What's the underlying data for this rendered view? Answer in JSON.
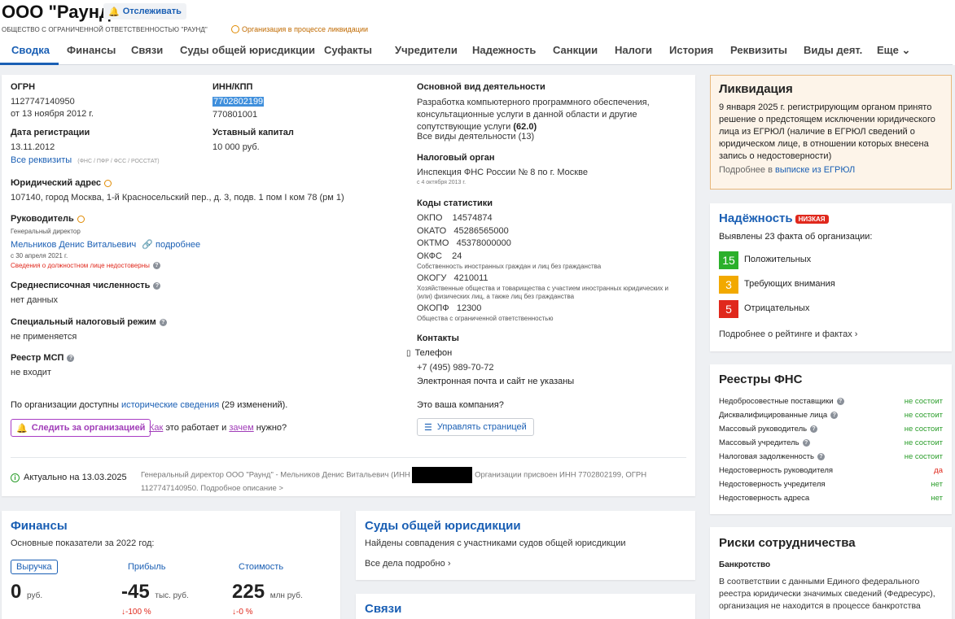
{
  "header": {
    "company_title": "ООО \"Раунд\"",
    "follow_label": "Отслеживать",
    "full_name": "ОБЩЕСТВО С ОГРАНИЧЕННОЙ ОТВЕТСТВЕННОСТЬЮ \"РАУНД\"",
    "status": "Организация в процессе ликвидации"
  },
  "tabs": [
    "Сводка",
    "Финансы",
    "Связи",
    "Суды общей юрисдикции",
    "Суфакты",
    "Учредители",
    "Надежность",
    "Санкции",
    "Налоги",
    "История",
    "Реквизиты",
    "Виды деят.",
    "Еще"
  ],
  "summary": {
    "ogrn_label": "ОГРН",
    "ogrn_value": "1127747140950",
    "ogrn_date": "от 13 ноября 2012 г.",
    "inn_label": "ИНН/КПП",
    "inn_value": "7702802199",
    "kpp_value": "770801001",
    "reg_label": "Дата регистрации",
    "reg_value": "13.11.2012",
    "capital_label": "Уставный капитал",
    "capital_value": "10 000 руб.",
    "all_requisites": "Все реквизиты",
    "requisites_sources": "(ФНС / ПФР / ФСС / РОССТАТ)",
    "address_label": "Юридический адрес",
    "address_value": "107140, город Москва, 1-й Красносельский пер., д. 3, подв. 1 пом I ком 78 (рм 1)",
    "head_label": "Руководитель",
    "head_role": "Генеральный директор",
    "head_name": "Мельников Денис Витальевич",
    "head_more": "подробнее",
    "head_since": "с 30 апреля 2021 г.",
    "head_warning": "Сведения о должностном лице недостоверны",
    "employees_label": "Среднесписочная численность",
    "employees_value": "нет данных",
    "tax_regime_label": "Специальный налоговый режим",
    "tax_regime_value": "не применяется",
    "msp_label": "Реестр МСП",
    "msp_value": "не входит",
    "history_text_pre": "По организации доступны",
    "history_link": "исторические сведения",
    "history_text_post": "(29 изменений).",
    "follow_org_btn": "Следить за организацией",
    "how_pre": "Как",
    "how_mid": "это работает и",
    "how_link": "зачем",
    "how_post": "нужно?",
    "activity_label": "Основной вид деятельности",
    "activity_value": "Разработка компьютерного программного обеспечения, консультационные услуги в данной области и другие сопутствующие услуги",
    "activity_code": "(62.0)",
    "activity_all": "Все виды деятельности (13)",
    "tax_authority_label": "Налоговый орган",
    "tax_authority_value": "Инспекция ФНС России № 8 по г. Москве",
    "tax_authority_date": "с 4 октября 2013 г.",
    "stat_label": "Коды статистики",
    "okpo": "ОКПО    14574874",
    "okato": "ОКАТО   45286565000",
    "oktmo": "ОКТМО   45378000000",
    "okfs": "ОКФС    24",
    "okfs_desc": "Собственность иностранных граждан и лиц без гражданства",
    "okogu": "ОКОГУ   4210011",
    "okogu_desc": "Хозяйственные общества и товарищества с участием иностранных юридических и (или) физических лиц, а также лиц без гражданства",
    "okopf": "ОКОПФ   12300",
    "okopf_desc": "Общества с ограниченной ответственностью",
    "contacts_label": "Контакты",
    "phone_label": "Телефон",
    "phone_value": "+7 (495) 989-70-72",
    "email_note": "Электронная почта и сайт не указаны",
    "your_company": "Это ваша компания?",
    "manage_btn": "Управлять страницей",
    "actual_date": "Актуально на 13.03.2025",
    "footer_text_1": "Генеральный директор ООО \"Раунд\" - Мельников Денис Витальевич (ИНН",
    "footer_text_2": "Организации присвоен ИНН 7702802199, ОГРН",
    "footer_text_3": "1127747140950. Подробное описание >"
  },
  "liquidation": {
    "title": "Ликвидация",
    "text": "9 января 2025 г. регистрирующим органом принято решение о предстоящем исключении юридического лица из ЕГРЮЛ (наличие в ЕГРЮЛ сведений о юридическом лице, в отношении которых внесена запись о недостоверности)",
    "more_pre": "Подробнее в",
    "more_link": "выписке из ЕГРЮЛ"
  },
  "reliability": {
    "title": "Надёжность",
    "badge": "НИЗКАЯ",
    "subtitle": "Выявлены 23 факта об организации:",
    "items": [
      {
        "count": "15",
        "label": "Положительных",
        "color": "#2bb02b"
      },
      {
        "count": "3",
        "label": "Требующих внимания",
        "color": "#f2a900"
      },
      {
        "count": "5",
        "label": "Отрицательных",
        "color": "#e0281c"
      }
    ],
    "more": "Подробнее о рейтинге и фактах"
  },
  "registries": {
    "title": "Реестры ФНС",
    "rows": [
      {
        "label": "Недобросовестные поставщики",
        "value": "не состоит",
        "q": true,
        "status": "green"
      },
      {
        "label": "Дисквалифицированные лица",
        "value": "не состоит",
        "q": true,
        "status": "green"
      },
      {
        "label": "Массовый руководитель",
        "value": "не состоит",
        "q": true,
        "status": "green"
      },
      {
        "label": "Массовый учредитель",
        "value": "не состоит",
        "q": true,
        "status": "green"
      },
      {
        "label": "Налоговая задолженность",
        "value": "не состоит",
        "q": true,
        "status": "green"
      },
      {
        "label": "Недостоверность руководителя",
        "value": "да",
        "q": false,
        "status": "red"
      },
      {
        "label": "Недостоверность учредителя",
        "value": "нет",
        "q": false,
        "status": "green"
      },
      {
        "label": "Недостоверность адреса",
        "value": "нет",
        "q": false,
        "status": "green"
      }
    ]
  },
  "risks": {
    "title": "Риски сотрудничества",
    "bankruptcy_label": "Банкротство",
    "bankruptcy_text": "В соответствии с данными Единого федерального реестра юридически значимых сведений (Федресурс), организация не находится в процессе банкротства"
  },
  "finances": {
    "title": "Финансы",
    "subtitle": "Основные показатели за 2022 год:",
    "revenue_label": "Выручка",
    "profit_label": "Прибыль",
    "value_label": "Стоимость",
    "revenue_value": "0",
    "revenue_unit": "руб.",
    "profit_value": "-45",
    "profit_unit": "тыс. руб.",
    "profit_change": "↓-100 %",
    "value_value": "225",
    "value_unit": "млн руб.",
    "value_change": "↓-0 %"
  },
  "courts": {
    "title": "Суды общей юрисдикции",
    "text": "Найдены совпадения с участниками судов общей юрисдикции",
    "link": "Все дела подробно"
  },
  "links": {
    "title": "Связи"
  }
}
